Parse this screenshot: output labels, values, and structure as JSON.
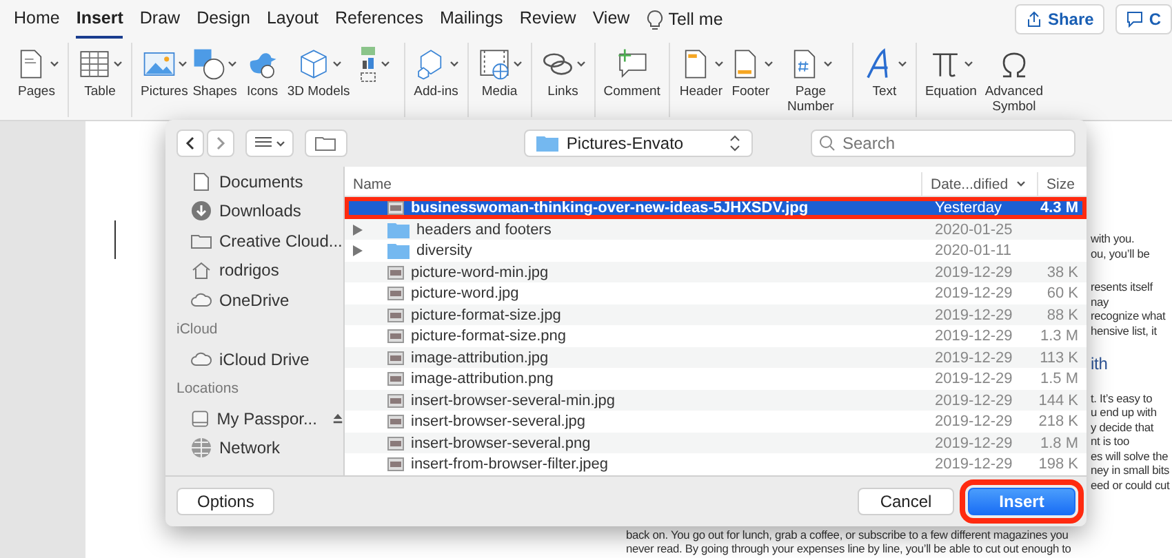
{
  "menu_tabs": [
    {
      "label": "Home",
      "selected": false
    },
    {
      "label": "Insert",
      "selected": true
    },
    {
      "label": "Draw",
      "selected": false
    },
    {
      "label": "Design",
      "selected": false
    },
    {
      "label": "Layout",
      "selected": false
    },
    {
      "label": "References",
      "selected": false
    },
    {
      "label": "Mailings",
      "selected": false
    },
    {
      "label": "Review",
      "selected": false
    },
    {
      "label": "View",
      "selected": false
    }
  ],
  "tell_me": "Tell me",
  "share_button": "Share",
  "comments_button": "C",
  "ribbon_groups": [
    {
      "items": [
        {
          "kind": "pages",
          "label": "Pages",
          "dropdown": true
        }
      ]
    },
    {
      "items": [
        {
          "kind": "table",
          "label": "Table",
          "dropdown": true
        }
      ]
    },
    {
      "items": [
        {
          "kind": "pictures",
          "label": "Pictures",
          "dropdown": true
        },
        {
          "kind": "shapes",
          "label": "Shapes",
          "dropdown": true
        },
        {
          "kind": "icons",
          "label": "Icons",
          "dropdown": false
        },
        {
          "kind": "models",
          "label": "3D Models",
          "dropdown": true
        },
        {
          "kind": "stack",
          "dropdown": true
        }
      ]
    },
    {
      "items": [
        {
          "kind": "addins",
          "label": "Add-ins",
          "dropdown": true
        }
      ]
    },
    {
      "items": [
        {
          "kind": "media",
          "label": "Media",
          "dropdown": true
        }
      ]
    },
    {
      "items": [
        {
          "kind": "links",
          "label": "Links",
          "dropdown": true
        }
      ]
    },
    {
      "items": [
        {
          "kind": "comment",
          "label": "Comment",
          "dropdown": false
        }
      ]
    },
    {
      "items": [
        {
          "kind": "header",
          "label": "Header",
          "dropdown": true
        },
        {
          "kind": "footer",
          "label": "Footer",
          "dropdown": true
        },
        {
          "kind": "pagenumber",
          "label": "Page Number",
          "dropdown": true
        }
      ]
    },
    {
      "items": [
        {
          "kind": "text",
          "label": "Text",
          "dropdown": true
        }
      ]
    },
    {
      "items": [
        {
          "kind": "equation",
          "label": "Equation",
          "dropdown": true
        },
        {
          "kind": "symbol",
          "label": "Advanced Symbol",
          "dropdown": false
        }
      ]
    }
  ],
  "document": {
    "side_paragraphs": [
      [
        "with you.",
        "ou, you’ll be"
      ],
      [
        "resents itself",
        "nay",
        "recognize what",
        "hensive list, it"
      ],
      [
        "ith"
      ],
      [
        "t. It’s easy to",
        "u end up with",
        "y decide that",
        "nt is too",
        "es will solve the",
        "ney in small bits",
        "eed or could cut"
      ]
    ],
    "bottom_lines": [
      "back on. You go out for lunch, grab a coffee, or subscribe to a few different magazines you",
      "never read. By going through your expenses line by line, you’ll be able to cut out enough to"
    ]
  },
  "dialog": {
    "location": "Pictures-Envato",
    "search": {
      "placeholder": "Search"
    },
    "sidebar": [
      {
        "kind": "documents",
        "label": "Documents"
      },
      {
        "kind": "downloads",
        "label": "Downloads"
      },
      {
        "kind": "folder",
        "label": "Creative Cloud..."
      },
      {
        "kind": "home",
        "label": "rodrigos"
      },
      {
        "kind": "cloud",
        "label": "OneDrive"
      },
      {
        "kind": "header",
        "label": "iCloud"
      },
      {
        "kind": "cloud",
        "label": "iCloud Drive"
      },
      {
        "kind": "header",
        "label": "Locations"
      },
      {
        "kind": "drive",
        "label": "My Passpor...",
        "eject": true
      },
      {
        "kind": "globe",
        "label": "Network"
      }
    ],
    "columns": [
      "Name",
      "Date...dified",
      "Size"
    ],
    "rows": [
      {
        "kind": "image",
        "name": "businesswoman-thinking-over-new-ideas-5JHXSDV.jpg",
        "date": "Yesterday",
        "size": "4.3 M",
        "selected": true,
        "highlighted": true
      },
      {
        "kind": "folder",
        "name": "headers and footers",
        "date": "2020-01-25",
        "selected": false,
        "highlighted": false
      },
      {
        "kind": "folder",
        "name": "diversity",
        "date": "2020-01-11",
        "selected": false,
        "highlighted": false
      },
      {
        "kind": "image",
        "name": "picture-word-min.jpg",
        "date": "2019-12-29",
        "size": "38 K",
        "selected": false,
        "highlighted": false
      },
      {
        "kind": "image",
        "name": "picture-word.jpg",
        "date": "2019-12-29",
        "size": "60 K",
        "selected": false,
        "highlighted": false
      },
      {
        "kind": "image",
        "name": "picture-format-size.jpg",
        "date": "2019-12-29",
        "size": "88 K",
        "selected": false,
        "highlighted": false
      },
      {
        "kind": "image",
        "name": "picture-format-size.png",
        "date": "2019-12-29",
        "size": "1.3 M",
        "selected": false,
        "highlighted": false
      },
      {
        "kind": "image",
        "name": "image-attribution.jpg",
        "date": "2019-12-29",
        "size": "113 K",
        "selected": false,
        "highlighted": false
      },
      {
        "kind": "image",
        "name": "image-attribution.png",
        "date": "2019-12-29",
        "size": "1.5 M",
        "selected": false,
        "highlighted": false
      },
      {
        "kind": "image",
        "name": "insert-browser-several-min.jpg",
        "date": "2019-12-29",
        "size": "144 K",
        "selected": false,
        "highlighted": false
      },
      {
        "kind": "image",
        "name": "insert-browser-several.jpg",
        "date": "2019-12-29",
        "size": "218 K",
        "selected": false,
        "highlighted": false
      },
      {
        "kind": "image",
        "name": "insert-browser-several.png",
        "date": "2019-12-29",
        "size": "1.8 M",
        "selected": false,
        "highlighted": false
      },
      {
        "kind": "image",
        "name": "insert-from-browser-filter.jpeg",
        "date": "2019-12-29",
        "size": "198 K",
        "selected": false,
        "highlighted": false
      }
    ],
    "buttons": [
      {
        "kind": "default",
        "label": "Options",
        "highlighted": false
      },
      {
        "kind": "default",
        "label": "Cancel",
        "highlighted": false
      },
      {
        "kind": "primary",
        "label": "Insert",
        "highlighted": true
      }
    ]
  }
}
